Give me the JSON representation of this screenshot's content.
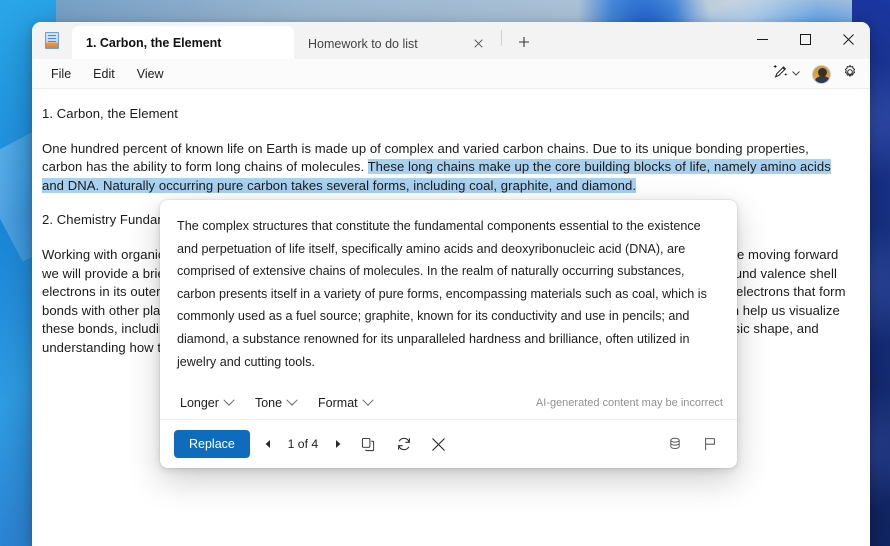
{
  "window": {
    "app_icon": "notepad-icon",
    "tabs": [
      {
        "label": "1. Carbon, the Element",
        "active": true,
        "close_icon": "close-icon"
      },
      {
        "label": "Homework to do list",
        "active": false,
        "close_icon": "close-icon"
      }
    ],
    "new_tab_label": "+",
    "controls": {
      "minimize": "minimize-icon",
      "maximize": "maximize-icon",
      "close": "close-icon"
    }
  },
  "menubar": {
    "items": [
      "File",
      "Edit",
      "View"
    ],
    "right_icons": [
      "ai-rewrite-icon",
      "chevron-down-icon",
      "account-avatar",
      "settings-gear-icon"
    ]
  },
  "document": {
    "heading1": "1. Carbon, the Element",
    "para1_plain": "One hundred percent of known life on Earth is made up of complex and varied carbon chains. Due to its unique bonding properties, carbon has the ability to form long chains of molecules. ",
    "para1_highlight": "These long chains make up the core building blocks of life, namely amino acids and DNA. Naturally occurring pure carbon takes several forms, including coal, graphite, and diamond.",
    "heading2": "2. Chemistry Fundamentals",
    "para2": "Working with organic chemistry and carbon compounds requires a solid understanding of valence shell theory, so before moving forward we will provide a brief review of valence shell theory—the idea that each atom has a set number of electrons that surround valence shell electrons in its outermost orbital shells. Carbon's ability to bond is due to the four atoms or molecules. Drawing out the electrons that form bonds with other play a pivotal role in how carbon atoms bond (known as Lewis dot structures) can help structures) can help us visualize these bonds, including resonant illuminate the eventual shape a molecule will take. Orbital shells can help tell us its basic shape, and understanding how to hybridise a molecule can"
  },
  "popup": {
    "generated_text": "The complex structures that constitute the fundamental components essential to the existence and perpetuation of life itself, specifically amino acids and deoxyribonucleic acid (DNA), are comprised of extensive chains of molecules. In the realm of naturally occurring substances, carbon presents itself in a variety of pure forms, encompassing materials such as coal, which is commonly used as a fuel source; graphite, known for its conductivity and use in pencils; and diamond, a substance renowned for its unparalleled hardness and brilliance, often utilized in jewelry and cutting tools.",
    "tools": [
      {
        "label": "Longer",
        "icon": "chevron-down-icon"
      },
      {
        "label": "Tone",
        "icon": "chevron-down-icon"
      },
      {
        "label": "Format",
        "icon": "chevron-down-icon"
      }
    ],
    "disclaimer": "AI-generated content may be incorrect",
    "replace_label": "Replace",
    "pager": "1 of 4",
    "prev_icon": "previous-arrow-icon",
    "next_icon": "next-arrow-icon",
    "copy_icon": "copy-icon",
    "regenerate_icon": "refresh-icon",
    "dismiss_icon": "close-icon",
    "credits_icon": "credits-stack-icon",
    "feedback_icon": "flag-icon"
  },
  "colors": {
    "accent": "#0f6cbd",
    "highlight": "#a8d0ef",
    "titlebar": "#f3f3f3",
    "menubar": "#fbfbfb"
  }
}
